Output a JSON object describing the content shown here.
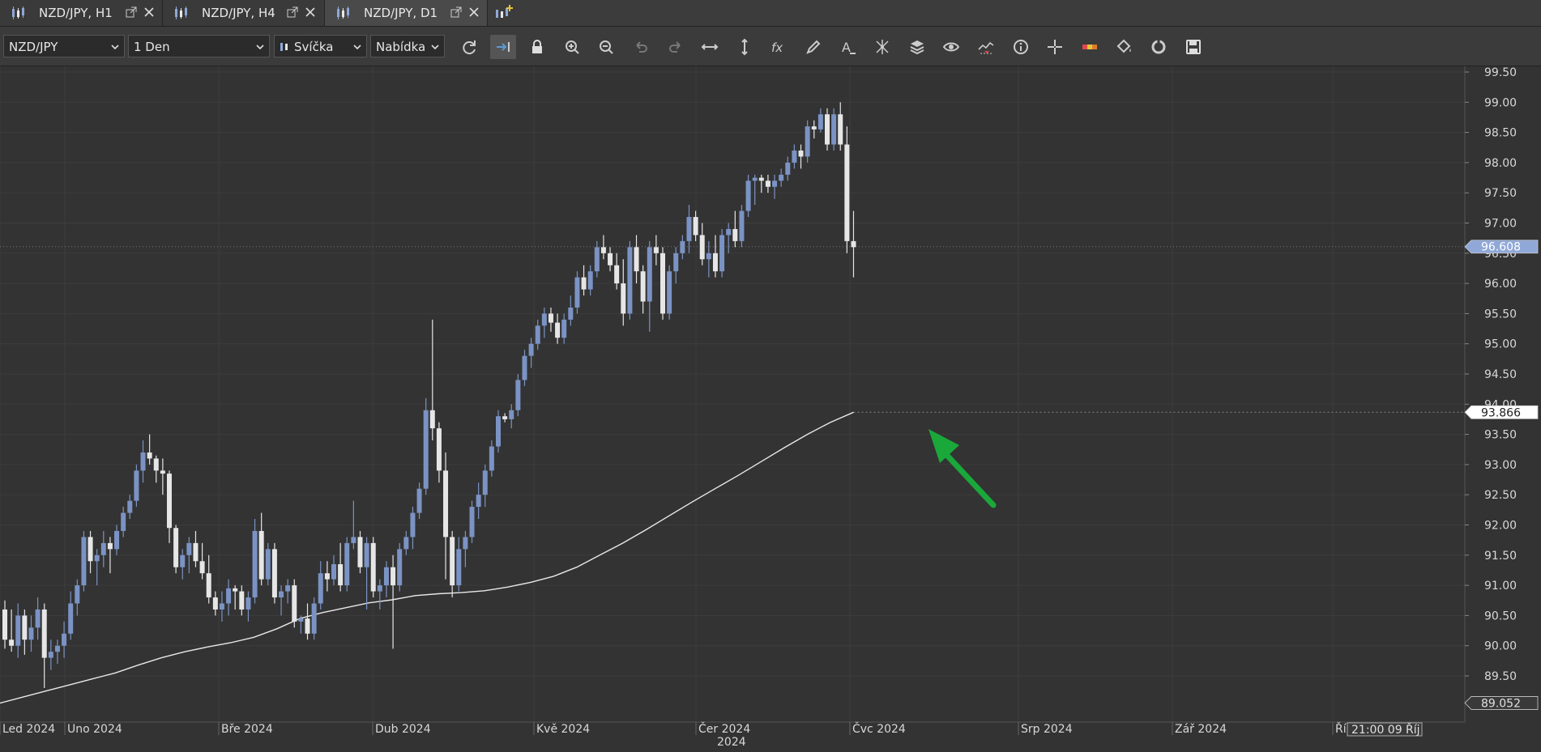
{
  "tabs": [
    {
      "label": "NZD/JPY, H1",
      "active": false
    },
    {
      "label": "NZD/JPY, H4",
      "active": false
    },
    {
      "label": "NZD/JPY, D1",
      "active": true
    }
  ],
  "toolbar": {
    "symbol": "NZD/JPY",
    "period": "1 Den",
    "chart_type": "Svíčka",
    "price_side": "Nabídka",
    "icons": [
      "refresh-icon",
      "autoscroll-icon",
      "lock-icon",
      "zoom-in-icon",
      "zoom-out-icon",
      "undo-icon",
      "redo-icon",
      "horizontal-scale-icon",
      "vertical-scale-icon",
      "indicators-fx-icon",
      "draw-pencil-icon",
      "text-tool-icon",
      "pattern-icon",
      "layers-icon",
      "eye-icon",
      "signal-icon",
      "info-icon",
      "crosshair-icon",
      "color-bars-icon",
      "paint-bucket-icon",
      "sync-icon",
      "save-icon"
    ]
  },
  "chart_data": {
    "type": "candlestick",
    "symbol": "NZD/JPY",
    "timeframe": "D1",
    "y_ticks": [
      "99.50",
      "99.00",
      "98.50",
      "98.00",
      "97.50",
      "97.00",
      "96.50",
      "96.00",
      "95.50",
      "95.00",
      "94.50",
      "94.00",
      "93.50",
      "93.00",
      "92.50",
      "92.00",
      "91.50",
      "91.00",
      "90.50",
      "90.00",
      "89.50"
    ],
    "ylim": [
      89.0,
      99.6
    ],
    "x_labels": [
      "Led 2024",
      "Uno 2024",
      "Bře 2024",
      "Dub 2024",
      "Kvě 2024",
      "Čer 2024",
      "Čvc 2024",
      "Srp 2024",
      "Zář 2024",
      "Ří"
    ],
    "year_label": "2024",
    "current_price": "96.608",
    "ma_value": "93.866",
    "cursor_price": "89.052",
    "time_tag": "21:00 09 Říj",
    "colors": {
      "bull": "#7b93c4",
      "bear": "#e6e6e6",
      "ma_line": "#e8e8e8",
      "arrow": "#1aa83a",
      "price_tag": "#8fa8d8"
    },
    "candles": [
      [
        90.6,
        90.75,
        89.95,
        90.1
      ],
      [
        90.1,
        90.6,
        89.9,
        90.0
      ],
      [
        90.0,
        90.7,
        89.8,
        90.5
      ],
      [
        90.5,
        90.6,
        89.85,
        90.1
      ],
      [
        90.1,
        90.5,
        89.9,
        90.3
      ],
      [
        90.3,
        90.8,
        90.1,
        90.6
      ],
      [
        90.6,
        90.7,
        89.3,
        89.8
      ],
      [
        89.8,
        90.1,
        89.6,
        89.9
      ],
      [
        89.9,
        90.1,
        89.7,
        90.0
      ],
      [
        90.0,
        90.4,
        89.8,
        90.2
      ],
      [
        90.2,
        90.9,
        90.1,
        90.7
      ],
      [
        90.7,
        91.1,
        90.5,
        91.0
      ],
      [
        91.0,
        91.9,
        90.9,
        91.8
      ],
      [
        91.8,
        91.9,
        91.2,
        91.4
      ],
      [
        91.4,
        91.6,
        91.0,
        91.5
      ],
      [
        91.5,
        91.9,
        91.3,
        91.7
      ],
      [
        91.7,
        91.8,
        91.2,
        91.6
      ],
      [
        91.6,
        92.0,
        91.5,
        91.9
      ],
      [
        91.9,
        92.3,
        91.8,
        92.2
      ],
      [
        92.2,
        92.5,
        92.1,
        92.4
      ],
      [
        92.4,
        93.0,
        92.3,
        92.9
      ],
      [
        92.9,
        93.4,
        92.7,
        93.2
      ],
      [
        93.2,
        93.5,
        93.0,
        93.1
      ],
      [
        93.1,
        93.15,
        92.7,
        92.9
      ],
      [
        92.9,
        93.1,
        92.5,
        92.85
      ],
      [
        92.85,
        92.9,
        91.7,
        91.95
      ],
      [
        91.95,
        92.0,
        91.2,
        91.3
      ],
      [
        91.3,
        91.6,
        91.1,
        91.5
      ],
      [
        91.5,
        91.8,
        91.2,
        91.7
      ],
      [
        91.7,
        91.9,
        91.3,
        91.4
      ],
      [
        91.4,
        91.7,
        91.1,
        91.2
      ],
      [
        91.2,
        91.5,
        90.7,
        90.8
      ],
      [
        90.8,
        90.9,
        90.5,
        90.6
      ],
      [
        90.6,
        90.9,
        90.4,
        90.7
      ],
      [
        90.7,
        91.1,
        90.5,
        90.95
      ],
      [
        90.95,
        91.0,
        90.6,
        90.9
      ],
      [
        90.9,
        91.0,
        90.5,
        90.6
      ],
      [
        90.6,
        90.9,
        90.4,
        90.8
      ],
      [
        90.8,
        92.1,
        90.7,
        91.9
      ],
      [
        91.9,
        92.2,
        91.0,
        91.1
      ],
      [
        91.1,
        91.7,
        91.0,
        91.6
      ],
      [
        91.6,
        91.7,
        90.7,
        90.8
      ],
      [
        90.8,
        91.0,
        90.5,
        90.9
      ],
      [
        90.9,
        91.1,
        90.7,
        91.0
      ],
      [
        91.0,
        91.1,
        90.3,
        90.4
      ],
      [
        90.4,
        90.5,
        90.2,
        90.45
      ],
      [
        90.45,
        90.7,
        90.1,
        90.2
      ],
      [
        90.2,
        90.8,
        90.1,
        90.7
      ],
      [
        90.7,
        91.4,
        90.6,
        91.2
      ],
      [
        91.2,
        91.4,
        90.9,
        91.1
      ],
      [
        91.1,
        91.5,
        91.0,
        91.35
      ],
      [
        91.35,
        91.7,
        90.9,
        91.0
      ],
      [
        91.0,
        91.8,
        90.9,
        91.7
      ],
      [
        91.7,
        92.4,
        91.6,
        91.8
      ],
      [
        91.8,
        91.9,
        91.2,
        91.3
      ],
      [
        91.3,
        91.8,
        90.6,
        91.7
      ],
      [
        91.7,
        91.8,
        90.8,
        90.9
      ],
      [
        90.9,
        91.1,
        90.6,
        91.0
      ],
      [
        91.0,
        91.4,
        90.8,
        91.3
      ],
      [
        91.3,
        91.5,
        89.95,
        91.0
      ],
      [
        91.0,
        91.7,
        90.9,
        91.6
      ],
      [
        91.6,
        91.9,
        91.5,
        91.8
      ],
      [
        91.8,
        92.3,
        91.6,
        92.2
      ],
      [
        92.2,
        92.7,
        92.1,
        92.6
      ],
      [
        92.6,
        94.1,
        92.5,
        93.9
      ],
      [
        93.9,
        95.4,
        93.4,
        93.6
      ],
      [
        93.6,
        93.7,
        92.7,
        92.9
      ],
      [
        92.9,
        93.2,
        91.1,
        91.8
      ],
      [
        91.8,
        91.9,
        90.8,
        91.0
      ],
      [
        91.0,
        91.8,
        90.9,
        91.6
      ],
      [
        91.6,
        91.9,
        91.3,
        91.8
      ],
      [
        91.8,
        92.4,
        91.7,
        92.3
      ],
      [
        92.3,
        92.7,
        92.1,
        92.5
      ],
      [
        92.5,
        93.0,
        92.3,
        92.9
      ],
      [
        92.9,
        93.4,
        92.8,
        93.3
      ],
      [
        93.3,
        93.9,
        93.2,
        93.8
      ],
      [
        93.8,
        93.85,
        93.7,
        93.75
      ],
      [
        93.75,
        94.0,
        93.6,
        93.9
      ],
      [
        93.9,
        94.5,
        93.8,
        94.4
      ],
      [
        94.4,
        94.9,
        94.3,
        94.8
      ],
      [
        94.8,
        95.1,
        94.6,
        95.0
      ],
      [
        95.0,
        95.4,
        94.9,
        95.3
      ],
      [
        95.3,
        95.6,
        95.1,
        95.5
      ],
      [
        95.5,
        95.6,
        95.2,
        95.35
      ],
      [
        95.35,
        95.5,
        95.0,
        95.1
      ],
      [
        95.1,
        95.5,
        95.0,
        95.4
      ],
      [
        95.4,
        95.8,
        95.3,
        95.6
      ],
      [
        95.6,
        96.2,
        95.5,
        96.1
      ],
      [
        96.1,
        96.3,
        95.8,
        95.9
      ],
      [
        95.9,
        96.3,
        95.8,
        96.2
      ],
      [
        96.2,
        96.7,
        96.1,
        96.6
      ],
      [
        96.6,
        96.8,
        96.4,
        96.5
      ],
      [
        96.5,
        96.6,
        96.2,
        96.3
      ],
      [
        96.3,
        96.5,
        95.9,
        96.0
      ],
      [
        96.0,
        96.4,
        95.3,
        95.5
      ],
      [
        95.5,
        96.7,
        95.4,
        96.6
      ],
      [
        96.6,
        96.8,
        96.0,
        96.2
      ],
      [
        96.2,
        96.3,
        95.5,
        95.7
      ],
      [
        95.7,
        96.7,
        95.2,
        96.6
      ],
      [
        96.6,
        96.8,
        96.3,
        96.5
      ],
      [
        96.5,
        96.6,
        95.4,
        95.5
      ],
      [
        95.5,
        96.3,
        95.4,
        96.2
      ],
      [
        96.2,
        96.6,
        96.0,
        96.5
      ],
      [
        96.5,
        96.8,
        96.4,
        96.7
      ],
      [
        96.7,
        97.3,
        96.5,
        97.1
      ],
      [
        97.1,
        97.2,
        96.7,
        96.8
      ],
      [
        96.8,
        97.0,
        96.3,
        96.4
      ],
      [
        96.4,
        96.7,
        96.1,
        96.5
      ],
      [
        96.5,
        96.8,
        96.1,
        96.2
      ],
      [
        96.2,
        96.9,
        96.1,
        96.8
      ],
      [
        96.8,
        97.0,
        96.5,
        96.9
      ],
      [
        96.9,
        97.2,
        96.6,
        96.7
      ],
      [
        96.7,
        97.3,
        96.6,
        97.2
      ],
      [
        97.2,
        97.8,
        97.1,
        97.7
      ],
      [
        97.7,
        97.8,
        97.3,
        97.75
      ],
      [
        97.75,
        97.8,
        97.5,
        97.7
      ],
      [
        97.7,
        97.8,
        97.5,
        97.6
      ],
      [
        97.6,
        97.8,
        97.4,
        97.7
      ],
      [
        97.7,
        97.9,
        97.6,
        97.8
      ],
      [
        97.8,
        98.1,
        97.7,
        98.0
      ],
      [
        98.0,
        98.3,
        97.9,
        98.2
      ],
      [
        98.2,
        98.3,
        97.9,
        98.1
      ],
      [
        98.1,
        98.7,
        98.0,
        98.6
      ],
      [
        98.6,
        98.7,
        98.4,
        98.55
      ],
      [
        98.55,
        98.9,
        98.5,
        98.8
      ],
      [
        98.8,
        98.9,
        98.2,
        98.3
      ],
      [
        98.3,
        98.9,
        98.2,
        98.8
      ],
      [
        98.8,
        99.0,
        98.2,
        98.3
      ],
      [
        98.3,
        98.6,
        96.5,
        96.7
      ],
      [
        96.7,
        97.2,
        96.1,
        96.6
      ]
    ],
    "ma": [
      89.05,
      89.15,
      89.25,
      89.35,
      89.45,
      89.55,
      89.68,
      89.8,
      89.9,
      89.98,
      90.05,
      90.14,
      90.28,
      90.45,
      90.55,
      90.63,
      90.71,
      90.76,
      90.83,
      90.86,
      90.88,
      90.91,
      90.97,
      91.05,
      91.15,
      91.3,
      91.5,
      91.7,
      91.92,
      92.15,
      92.38,
      92.6,
      92.82,
      93.05,
      93.28,
      93.5,
      93.7,
      93.866
    ]
  }
}
